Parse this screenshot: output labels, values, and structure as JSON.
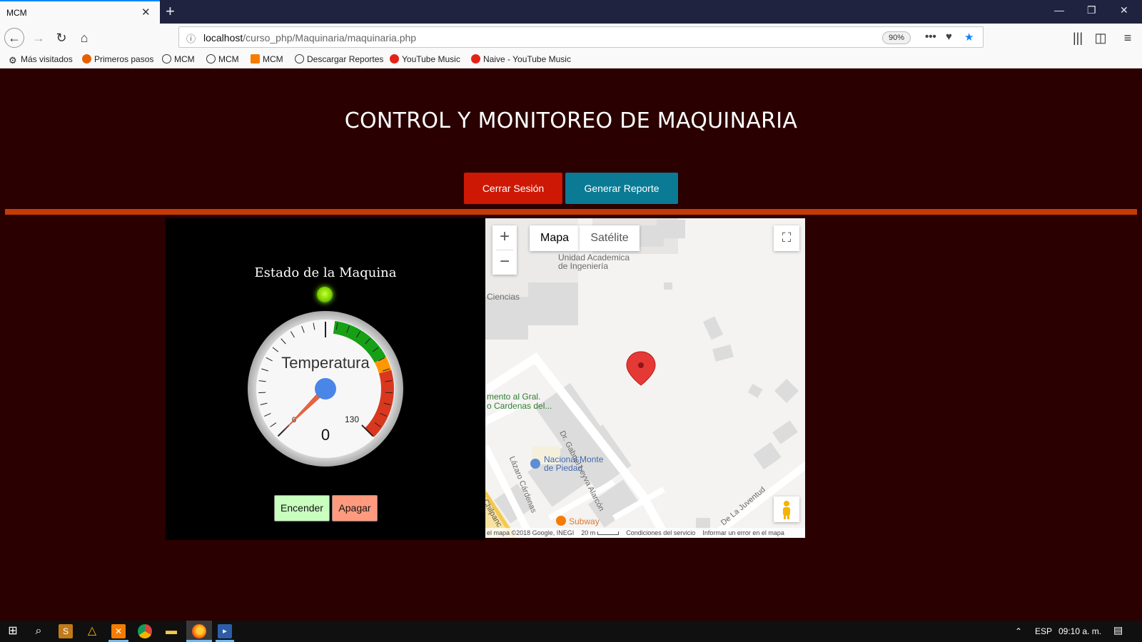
{
  "browser": {
    "tab_title": "MCM",
    "url_host": "localhost",
    "url_path": "/curso_php/Maquinaria/maquinaria.php",
    "zoom": "90%",
    "bookmarks": [
      "Más visitados",
      "Primeros pasos",
      "MCM",
      "MCM",
      "MCM",
      "Descargar Reportes",
      "YouTube Music",
      "Naive - YouTube Music"
    ]
  },
  "header": {
    "title": "CONTROL Y MONITOREO DE MAQUINARIA",
    "logout_label": "Cerrar Sesión",
    "report_label": "Generar Reporte"
  },
  "machine": {
    "status_title": "Estado de la Maquina",
    "gauge_label": "Temperatura",
    "gauge_value": "0",
    "gauge_min": "0",
    "gauge_max": "130",
    "gauge_reading": 0,
    "on_label": "Encender",
    "off_label": "Apagar",
    "led_color": "#7ed400"
  },
  "map": {
    "tab_map": "Mapa",
    "tab_satellite": "Satélite",
    "labels": {
      "unidad": "Unidad Academica",
      "ingenieria": "de Ingeniería",
      "ciencias": "Ciencias",
      "monumento1": "mento al Gral.",
      "monumento2": "o Cardenas del...",
      "monte1": "Nacional Monte",
      "monte2": "de Piedad",
      "subway": "Subway",
      "street_leyva": "Dr. Gabriel Leyva Alarcón",
      "street_lazaro": "Lázaro Cárdenas",
      "street_juventud": "De La Juventud",
      "street_chilpanc": "Chilpanc"
    },
    "footer": {
      "data": "el mapa ©2018 Google, INEGI",
      "scale": "20 m",
      "terms": "Condiciones del servicio",
      "report": "Informar un error en el mapa"
    }
  },
  "taskbar": {
    "lang": "ESP",
    "time": "09:10 a. m."
  }
}
